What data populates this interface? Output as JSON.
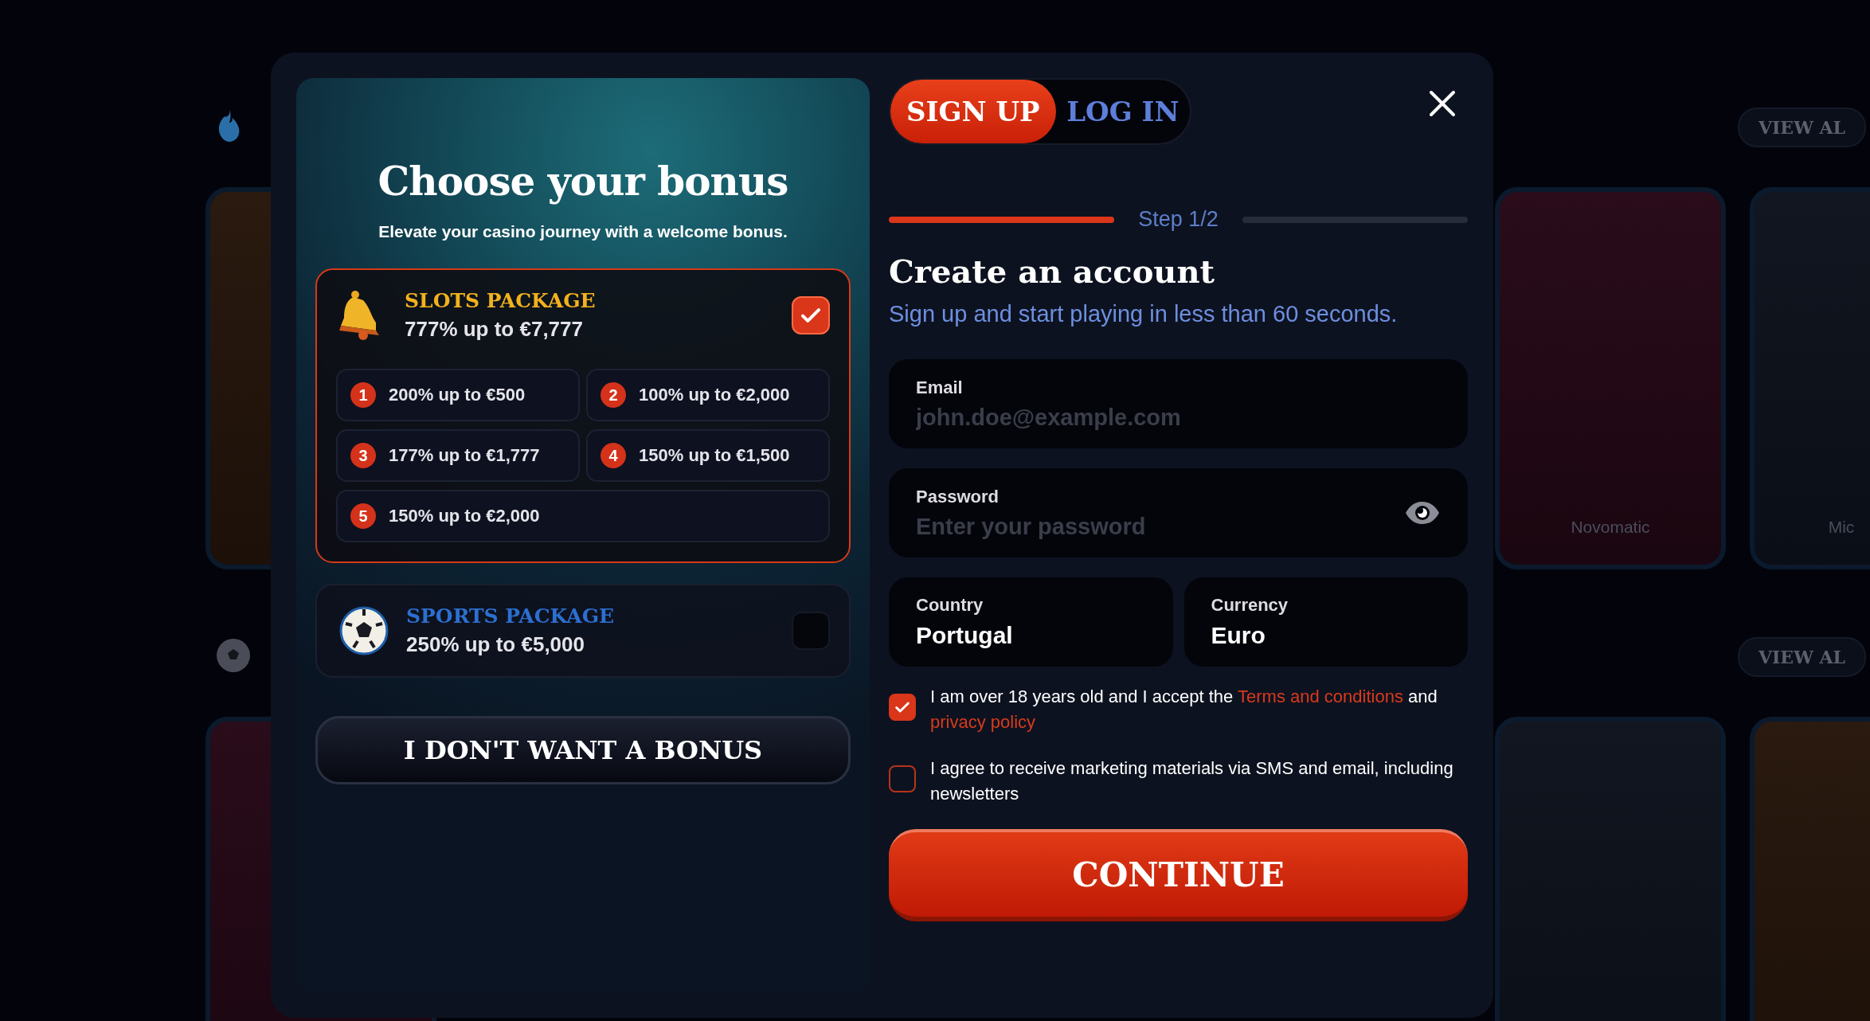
{
  "background": {
    "sections": [
      {
        "kind": "casino",
        "view_all": "VIEW AL",
        "tiles": [
          {
            "kind": "game"
          },
          {
            "kind": "game",
            "caption": "Novomatic"
          },
          {
            "kind": "game",
            "caption": "Mic"
          }
        ]
      },
      {
        "kind": "sports",
        "view_all": "VIEW AL",
        "tiles": [
          {
            "kind": "game"
          },
          {
            "kind": "game"
          },
          {
            "kind": "game"
          }
        ]
      }
    ]
  },
  "bonus_panel": {
    "title": "Choose your bonus",
    "subtitle": "Elevate your casino journey with a welcome bonus.",
    "packages": [
      {
        "kind": "slots",
        "title": "SLOTS PACKAGE",
        "offer": "777% up to €7,777",
        "selected": true,
        "options": [
          {
            "number": "1",
            "text": "200% up to €500"
          },
          {
            "number": "2",
            "text": "100% up to €2,000"
          },
          {
            "number": "3",
            "text": "177% up to €1,777"
          },
          {
            "number": "4",
            "text": "150% up to €1,500"
          },
          {
            "number": "5",
            "text": "150% up to €2,000"
          }
        ]
      },
      {
        "kind": "sports",
        "title": "SPORTS PACKAGE",
        "offer": "250% up to €5,000",
        "selected": false
      }
    ],
    "no_bonus_button": "I DON'T WANT A BONUS"
  },
  "auth": {
    "tabs": [
      {
        "label": "SIGN UP",
        "selected": true
      },
      {
        "label": "LOG IN",
        "selected": false
      }
    ],
    "step": {
      "label": "Step 1/2",
      "segments": [
        {
          "complete": true
        },
        {
          "complete": false
        }
      ]
    },
    "heading": "Create an account",
    "subheading": "Sign up and start playing in less than 60 seconds.",
    "fields": [
      {
        "kind": "text",
        "label": "Email",
        "placeholder": "john.doe@example.com"
      },
      {
        "kind": "password",
        "label": "Password",
        "placeholder": "Enter your password"
      }
    ],
    "selects": [
      {
        "label": "Country",
        "value": "Portugal"
      },
      {
        "label": "Currency",
        "value": "Euro"
      }
    ],
    "consents": [
      {
        "checked": true,
        "segments": [
          {
            "kind": "text",
            "text": "I am over 18 years old and I accept the "
          },
          {
            "kind": "link",
            "text": "Terms and conditions"
          },
          {
            "kind": "text",
            "text": " and "
          },
          {
            "kind": "link",
            "text": "privacy policy"
          }
        ]
      },
      {
        "checked": false,
        "segments": [
          {
            "kind": "text",
            "text": "I agree to receive marketing materials via SMS and email, including newsletters"
          }
        ]
      }
    ],
    "continue_button": "CONTINUE"
  }
}
